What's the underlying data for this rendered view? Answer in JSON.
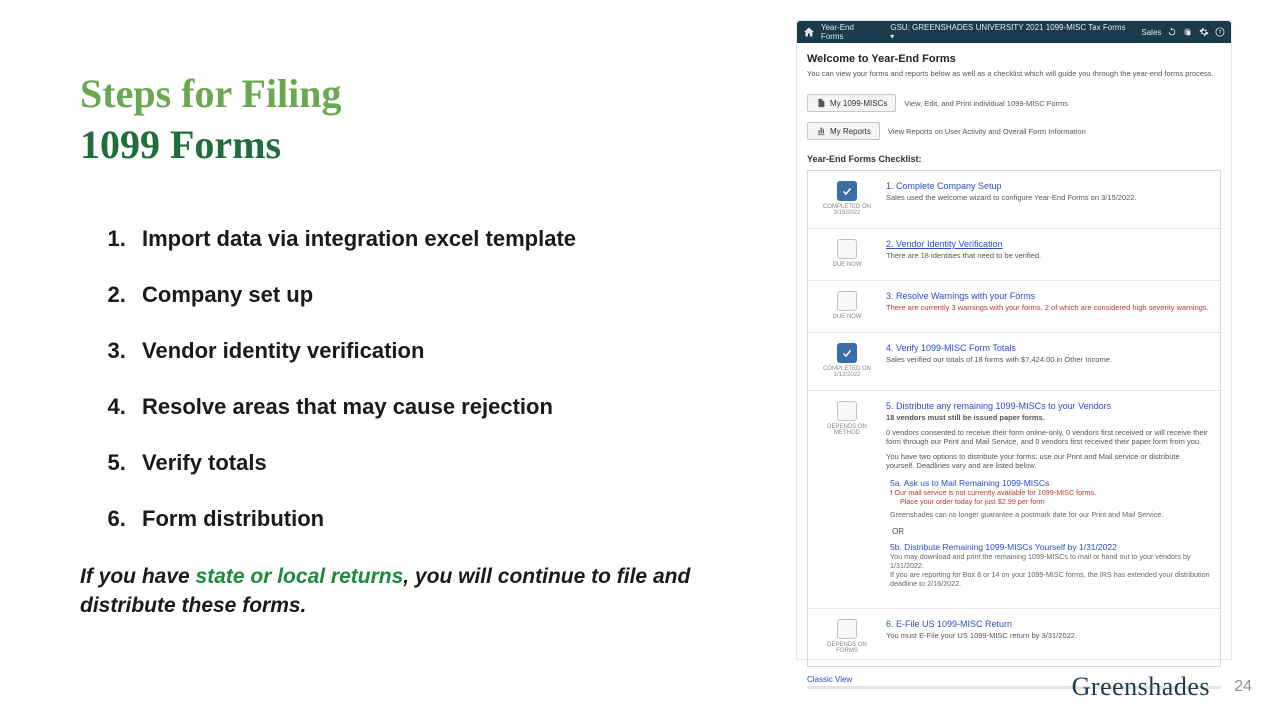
{
  "title": {
    "line1": "Steps for Filing",
    "line2": "1099 Forms"
  },
  "steps": [
    "Import data via integration excel template",
    "Company set up",
    "Vendor identity verification",
    "Resolve areas that may cause rejection",
    "Verify totals",
    "Form distribution"
  ],
  "note_prefix": "If you have ",
  "note_hl": "state or local returns",
  "note_suffix": ", you will continue to file and distribute these forms.",
  "brand": "Greenshades",
  "page_number": "24",
  "topbar": {
    "crumb": "Year-End Forms",
    "center": "GSU: GREENSHADES UNIVERSITY 2021 1099-MISC Tax Forms ▾",
    "user": "Sales"
  },
  "welcome": {
    "heading": "Welcome to Year-End Forms",
    "sub": "You can view your forms and reports below as well as a checklist which will guide you through the year-end forms process."
  },
  "buttons": {
    "my1099": "My 1099-MISCs",
    "my1099_desc": "View, Edit, and Print individual 1099-MISC Forms",
    "myreports": "My Reports",
    "myreports_desc": "View Reports on User Activity and Overall Form Information"
  },
  "checklist_title": "Year-End Forms Checklist:",
  "items": {
    "i1": {
      "status": "COMPLETED ON 3/15/2022",
      "title": "1. Complete Company Setup",
      "desc": "Sales used the welcome wizard to configure Year-End Forms on 3/15/2022."
    },
    "i2": {
      "status": "DUE NOW",
      "title": "2. Vendor Identity Verification",
      "desc": "There are 18 identities that need to be verified."
    },
    "i3": {
      "status": "DUE NOW",
      "title": "3. Resolve Warnings with your Forms",
      "desc": "There are currently 3 warnings with your forms, 2 of which are considered high severity warnings."
    },
    "i4": {
      "status": "COMPLETED ON 1/12/2022",
      "title": "4. Verify 1099-MISC Form Totals",
      "desc": "Sales verified our totals of 18 forms with $7,424.00 in Other Income."
    },
    "i5": {
      "status": "DEPENDS ON METHOD",
      "title": "5. Distribute any remaining 1099-MISCs to your Vendors",
      "desc_bold": "18 vendors must still be issued paper forms.",
      "desc1": "0 vendors consented to receive their form online-only, 0 vendors first received or will receive their form through our Print and Mail Service, and 0 vendors first received their paper form from you.",
      "desc2": "You have two options to distribute your forms: use our Print and Mail service or distribute yourself. Deadlines vary and are listed below.",
      "opt_a_label": "5a. Ask us to Mail Remaining 1099-MISCs",
      "opt_a_red1": "Our mail service is not currently available for 1099-MISC forms.",
      "opt_a_red2": "Place your order today for just $2.99 per form",
      "opt_a_sm": "Greenshades can no longer guarantee a postmark date for our Print and Mail Service.",
      "or": "OR",
      "opt_b_label": "5b. Distribute Remaining 1099-MISCs Yourself by 1/31/2022",
      "opt_b_sm1": "You may download and print the remaining 1099-MISCs to mail or hand out to your vendors by 1/31/2022.",
      "opt_b_sm2": "If you are reporting for Box 8 or 14 on your 1099-MISC forms, the IRS has extended your distribution deadline to 2/16/2022."
    },
    "i6": {
      "status": "DEPENDS ON FORMS",
      "title": "6. E-File US 1099-MISC Return",
      "desc": "You must E-File your US 1099-MISC return by 3/31/2022."
    }
  },
  "classic_view": "Classic View"
}
